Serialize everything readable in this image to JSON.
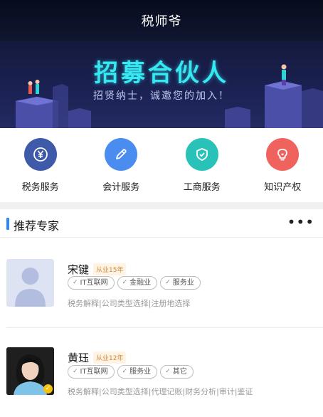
{
  "app": {
    "title": "税师爷"
  },
  "banner": {
    "headline": "招募合伙人",
    "subtitle": "招贤纳士，诚邀您的加入！"
  },
  "services": [
    {
      "label": "税务服务",
      "color": "#3f5aa8",
      "icon": "yen-icon"
    },
    {
      "label": "会计服务",
      "color": "#4a8cf0",
      "icon": "pencil-icon"
    },
    {
      "label": "工商服务",
      "color": "#28c2b8",
      "icon": "shield-icon"
    },
    {
      "label": "知识产权",
      "color": "#f0625e",
      "icon": "lightbulb-icon"
    }
  ],
  "section": {
    "title": "推荐专家",
    "more": "•••"
  },
  "experts": [
    {
      "name": "宋键",
      "years": "从业15年",
      "tags": [
        "IT互联网",
        "金融业",
        "服务业"
      ],
      "desc": "税务解释|公司类型选择|注册地选择"
    },
    {
      "name": "黄珏",
      "years": "从业12年",
      "tags": [
        "IT互联网",
        "服务业",
        "其它"
      ],
      "desc": "税务解释|公司类型选择|代理记账|财务分析|审计|鉴证"
    }
  ],
  "colors": {
    "accent": "#2f86ff",
    "years_tag": "#d08a3a",
    "banner_headline": "#35e8f2"
  }
}
